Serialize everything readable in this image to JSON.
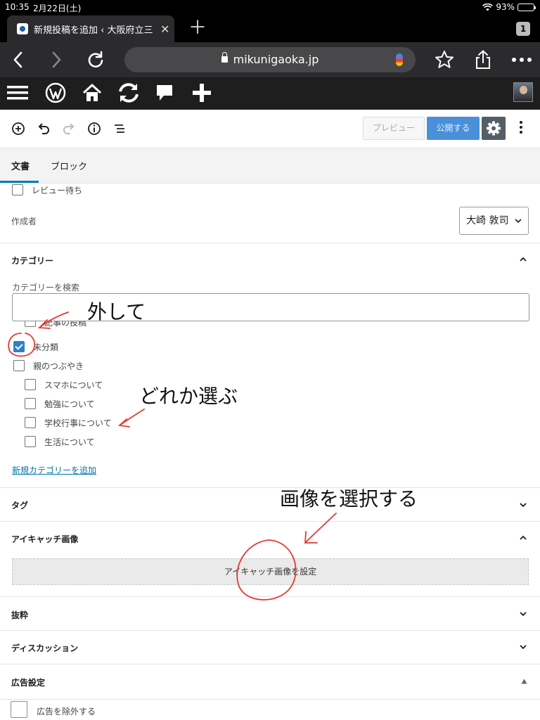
{
  "status": {
    "time": "10:35",
    "date": "2月22日(土)",
    "battery": "93%",
    "battery_level": 0.93
  },
  "browser": {
    "tab_title": "新規投稿を追加 ‹ 大阪府立三",
    "tab_count": "1",
    "url": "mikunigaoka.jp"
  },
  "toolbar": {
    "preview": "プレビュー",
    "publish": "公開する"
  },
  "sidebar": {
    "tabs": [
      "文書",
      "ブロック"
    ],
    "review": "レビュー待ち",
    "author_label": "作成者",
    "author_value": "大崎 敦司"
  },
  "categories": {
    "heading": "カテゴリー",
    "search_label": "カテゴリーを検索",
    "items": [
      {
        "label": "記事の投稿",
        "checked": false
      },
      {
        "label": "未分類",
        "checked": true
      },
      {
        "label": "親のつぶやき",
        "checked": false
      },
      {
        "label": "スマホについて",
        "checked": false
      },
      {
        "label": "勉強について",
        "checked": false
      },
      {
        "label": "学校行事について",
        "checked": false
      },
      {
        "label": "生活について",
        "checked": false
      }
    ],
    "add_link": "新規カテゴリーを追加"
  },
  "panels": {
    "tags": "タグ",
    "featured": "アイキャッチ画像",
    "featured_button": "アイキャッチ画像を設定",
    "excerpt": "抜粋",
    "discussion": "ディスカッション",
    "ads": "広告設定",
    "ads_exclude": "広告を除外する"
  },
  "annotations": {
    "remove": "外して",
    "choose": "どれか選ぶ",
    "select_image": "画像を選択する"
  },
  "colors": {
    "accent": "#007cba",
    "publish": "#4a90d9",
    "annotation": "#e53935"
  }
}
